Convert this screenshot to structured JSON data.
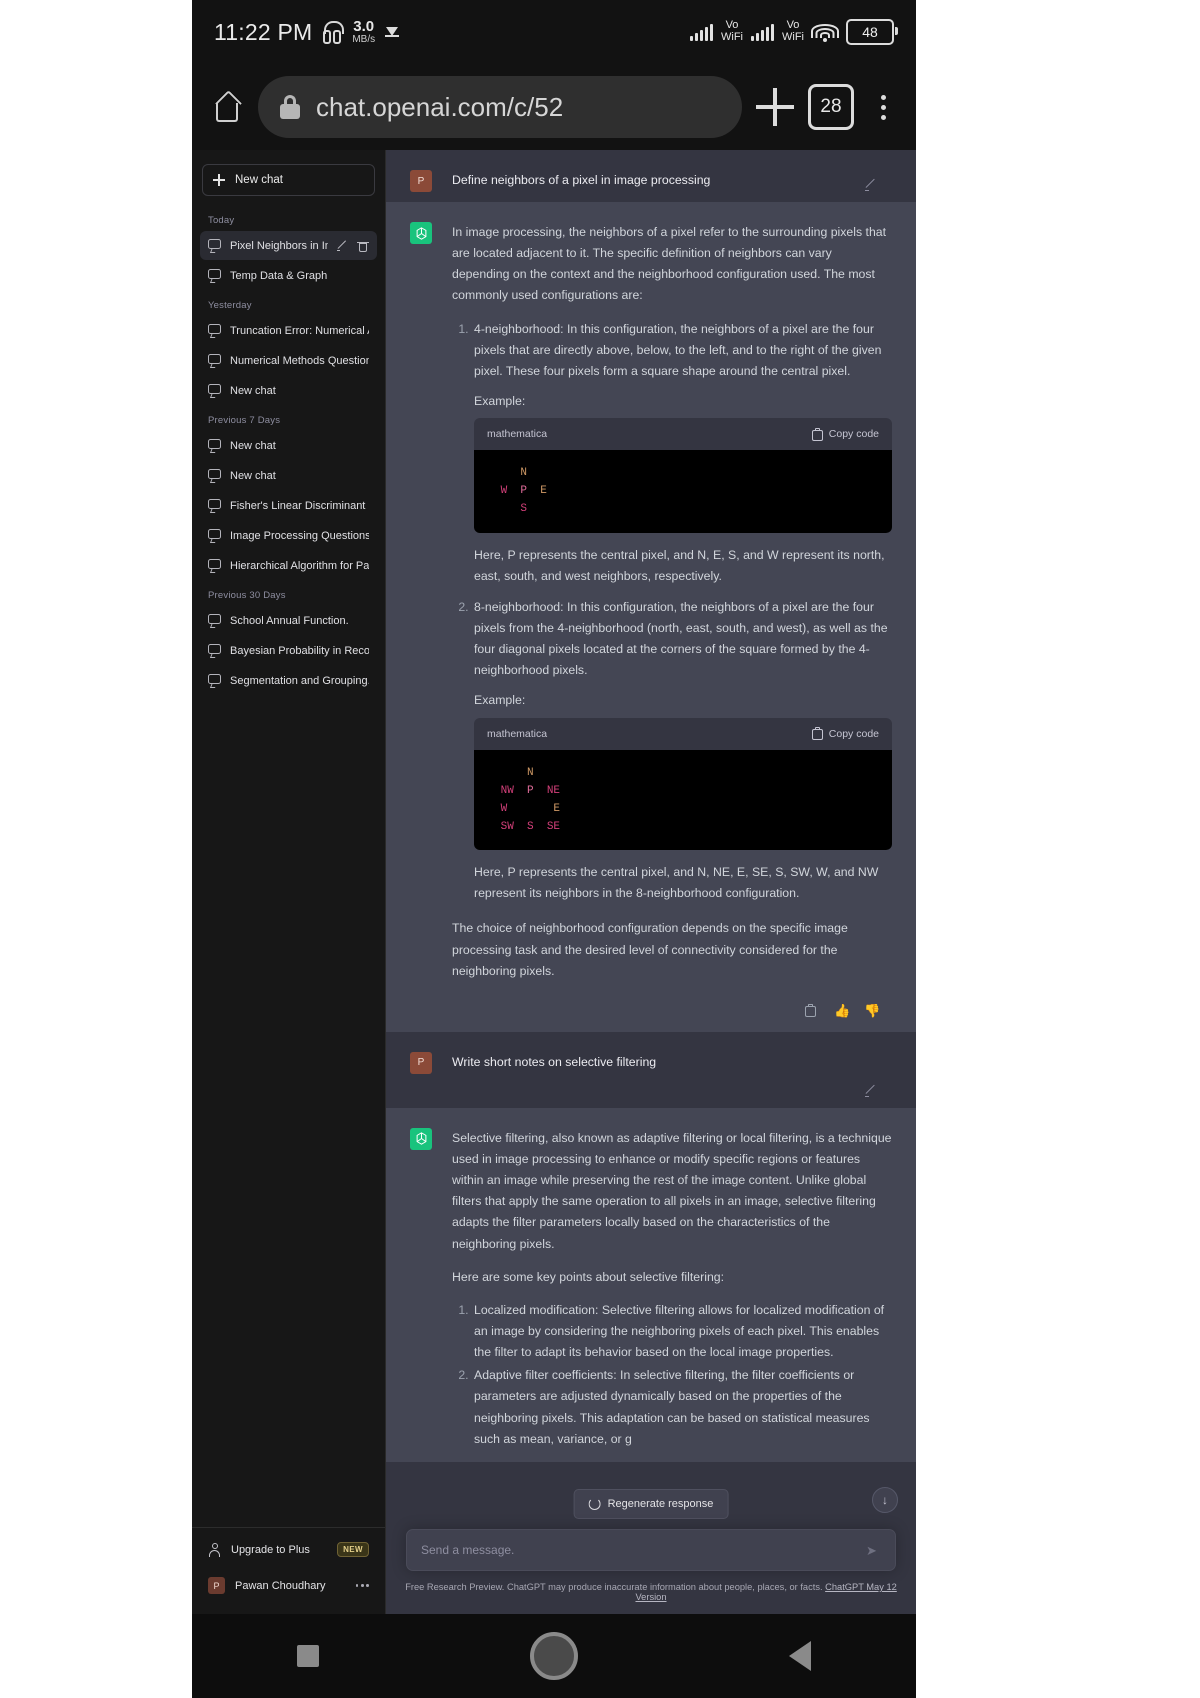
{
  "status_bar": {
    "time": "11:22 PM",
    "net_speed_value": "3.0",
    "net_speed_unit": "MB/s",
    "sim1_label_top": "Vo",
    "sim1_label_bottom": "WiFi",
    "sim2_label_top": "Vo",
    "sim2_label_bottom": "WiFi",
    "battery": "48"
  },
  "browser": {
    "url": "chat.openai.com/c/52",
    "tab_count": "28"
  },
  "sidebar": {
    "new_chat_label": "New chat",
    "sections": [
      {
        "label": "Today",
        "items": [
          {
            "title": "Pixel Neighbors in Imag",
            "active": true
          },
          {
            "title": "Temp Data & Graph",
            "active": false
          }
        ]
      },
      {
        "label": "Yesterday",
        "items": [
          {
            "title": "Truncation Error: Numerical A",
            "active": false
          },
          {
            "title": "Numerical Methods Question",
            "active": false
          },
          {
            "title": "New chat",
            "active": false
          }
        ]
      },
      {
        "label": "Previous 7 Days",
        "items": [
          {
            "title": "New chat",
            "active": false
          },
          {
            "title": "New chat",
            "active": false
          },
          {
            "title": "Fisher's Linear Discriminant",
            "active": false
          },
          {
            "title": "Image Processing Questions",
            "active": false
          },
          {
            "title": "Hierarchical Algorithm for Patt",
            "active": false
          }
        ]
      },
      {
        "label": "Previous 30 Days",
        "items": [
          {
            "title": "School Annual Function.",
            "active": false
          },
          {
            "title": "Bayesian Probability in Recogn",
            "active": false
          },
          {
            "title": "Segmentation and Grouping.",
            "active": false
          }
        ]
      }
    ],
    "footer": {
      "upgrade_label": "Upgrade to Plus",
      "upgrade_badge": "NEW",
      "user_name": "Pawan Choudhary",
      "user_initial": "P"
    }
  },
  "conversation": {
    "user_initial": "P",
    "messages": {
      "user1": "Define neighbors of a pixel in image processing",
      "bot1_intro": "In image processing, the neighbors of a pixel refer to the surrounding pixels that are located adjacent to it. The specific definition of neighbors can vary depending on the context and the neighborhood configuration used. The most commonly used configurations are:",
      "bot1_item1": "4-neighborhood: In this configuration, the neighbors of a pixel are the four pixels that are directly above, below, to the left, and to the right of the given pixel. These four pixels form a square shape around the central pixel.",
      "bot1_example_label_1": "Example:",
      "code1_lang": "mathematica",
      "code1_copy": "Copy code",
      "code1_lines": [
        {
          "indent": 4,
          "cells": [
            {
              "text": "N",
              "color": "n"
            }
          ]
        },
        {
          "indent": 1,
          "cells": [
            {
              "text": "W",
              "color": "pk"
            },
            {
              "text": "P",
              "color": "p"
            },
            {
              "text": "E",
              "color": "n"
            }
          ]
        },
        {
          "indent": 4,
          "cells": [
            {
              "text": "S",
              "color": "pk"
            }
          ]
        }
      ],
      "bot1_after_code1": "Here, P represents the central pixel, and N, E, S, and W represent its north, east, south, and west neighbors, respectively.",
      "bot1_item2": "8-neighborhood: In this configuration, the neighbors of a pixel are the four pixels from the 4-neighborhood (north, east, south, and west), as well as the four diagonal pixels located at the corners of the square formed by the 4-neighborhood pixels.",
      "bot1_example_label_2": "Example:",
      "code2_lang": "mathematica",
      "code2_copy": "Copy code",
      "code2_lines": [
        {
          "indent": 4,
          "cells": [
            {
              "text": "N",
              "color": "n"
            }
          ]
        },
        {
          "indent": 1,
          "cells": [
            {
              "text": "NW",
              "color": "pk"
            },
            {
              "text": "P",
              "color": "p"
            },
            {
              "text": "NE",
              "color": "pk"
            }
          ]
        },
        {
          "indent": 1,
          "cells": [
            {
              "text": "W",
              "color": "pk"
            },
            {
              "text": "",
              "color": "p"
            },
            {
              "text": "E",
              "color": "n"
            }
          ]
        },
        {
          "indent": 1,
          "cells": [
            {
              "text": "SW",
              "color": "pk"
            },
            {
              "text": "S",
              "color": "pk"
            },
            {
              "text": "SE",
              "color": "pk"
            }
          ]
        }
      ],
      "bot1_after_code2": "Here, P represents the central pixel, and N, NE, E, SE, S, SW, W, and NW represent its neighbors in the 8-neighborhood configuration.",
      "bot1_closing": "The choice of neighborhood configuration depends on the specific image processing task and the desired level of connectivity considered for the neighboring pixels.",
      "user2": "Write short notes on selective filtering",
      "bot2_intro": "Selective filtering, also known as adaptive filtering or local filtering, is a technique used in image processing to enhance or modify specific regions or features within an image while preserving the rest of the image content. Unlike global filters that apply the same operation to all pixels in an image, selective filtering adapts the filter parameters locally based on the characteristics of the neighboring pixels.",
      "bot2_keypoints_lead": "Here are some key points about selective filtering:",
      "bot2_item1": "Localized modification: Selective filtering allows for localized modification of an image by considering the neighboring pixels of each pixel. This enables the filter to adapt its behavior based on the local image properties.",
      "bot2_item2": "Adaptive filter coefficients: In selective filtering, the filter coefficients or parameters are adjusted dynamically based on the properties of the neighboring pixels. This adaptation can be based on statistical measures such as mean, variance, or g"
    },
    "regenerate_label": "Regenerate response"
  },
  "composer": {
    "placeholder": "Send a message."
  },
  "disclaimer": {
    "text": "Free Research Preview. ChatGPT may produce inaccurate information about people, places, or facts. ",
    "link": "ChatGPT May 12 Version"
  },
  "colors": {
    "accent_green": "#19c37d",
    "user_avatar": "#8b4a38",
    "bot_bg": "#444654",
    "chat_bg": "#343541",
    "sidebar_bg": "#171717",
    "badge_new": "#e3cf8a"
  }
}
